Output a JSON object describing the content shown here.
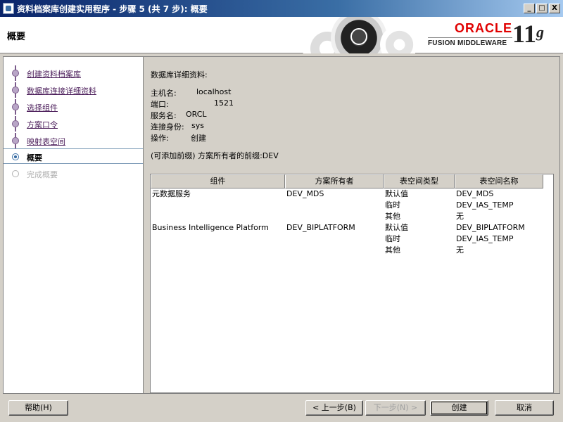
{
  "window": {
    "title": "资料档案库创建实用程序 - 步骤 5 (共 7 步): 概要",
    "minimize": "_",
    "maximize": "□",
    "close": "X"
  },
  "header": {
    "page_title": "概要",
    "brand": {
      "oracle": "ORACLE",
      "fusion": "FUSION MIDDLEWARE",
      "version": "11",
      "version_suffix": "g"
    }
  },
  "nav": {
    "steps": [
      {
        "label": "创建资料档案库",
        "state": "done"
      },
      {
        "label": "数据库连接详细资料",
        "state": "done"
      },
      {
        "label": "选择组件",
        "state": "done"
      },
      {
        "label": "方案口令",
        "state": "done"
      },
      {
        "label": "映射表空间",
        "state": "done"
      },
      {
        "label": "概要",
        "state": "current"
      },
      {
        "label": "完成概要",
        "state": "disabled"
      }
    ]
  },
  "details": {
    "section_title": "数据库详细资料:",
    "rows": [
      {
        "key": "主机名:",
        "value": "localhost"
      },
      {
        "key": "端口:",
        "value": "1521"
      },
      {
        "key": "服务名:",
        "value": "ORCL"
      },
      {
        "key": "连接身份:",
        "value": "sys"
      },
      {
        "key": "操作:",
        "value": "创建"
      }
    ],
    "prefix_line": "(可添加前缀) 方案所有者的前缀:DEV"
  },
  "table": {
    "headers": [
      "组件",
      "方案所有者",
      "表空间类型",
      "表空间名称"
    ],
    "rows": [
      [
        "元数据服务",
        "DEV_MDS",
        "默认值",
        "DEV_MDS"
      ],
      [
        "",
        "",
        "临时",
        "DEV_IAS_TEMP"
      ],
      [
        "",
        "",
        "其他",
        "无"
      ],
      [
        "Business Intelligence Platform",
        "DEV_BIPLATFORM",
        "默认值",
        "DEV_BIPLATFORM"
      ],
      [
        "",
        "",
        "临时",
        "DEV_IAS_TEMP"
      ],
      [
        "",
        "",
        "其他",
        "无"
      ]
    ]
  },
  "buttons": {
    "help": "帮助(H)",
    "back": "< 上一步(B)",
    "next": "下一步(N) >",
    "create": "创建",
    "cancel": "取消"
  }
}
